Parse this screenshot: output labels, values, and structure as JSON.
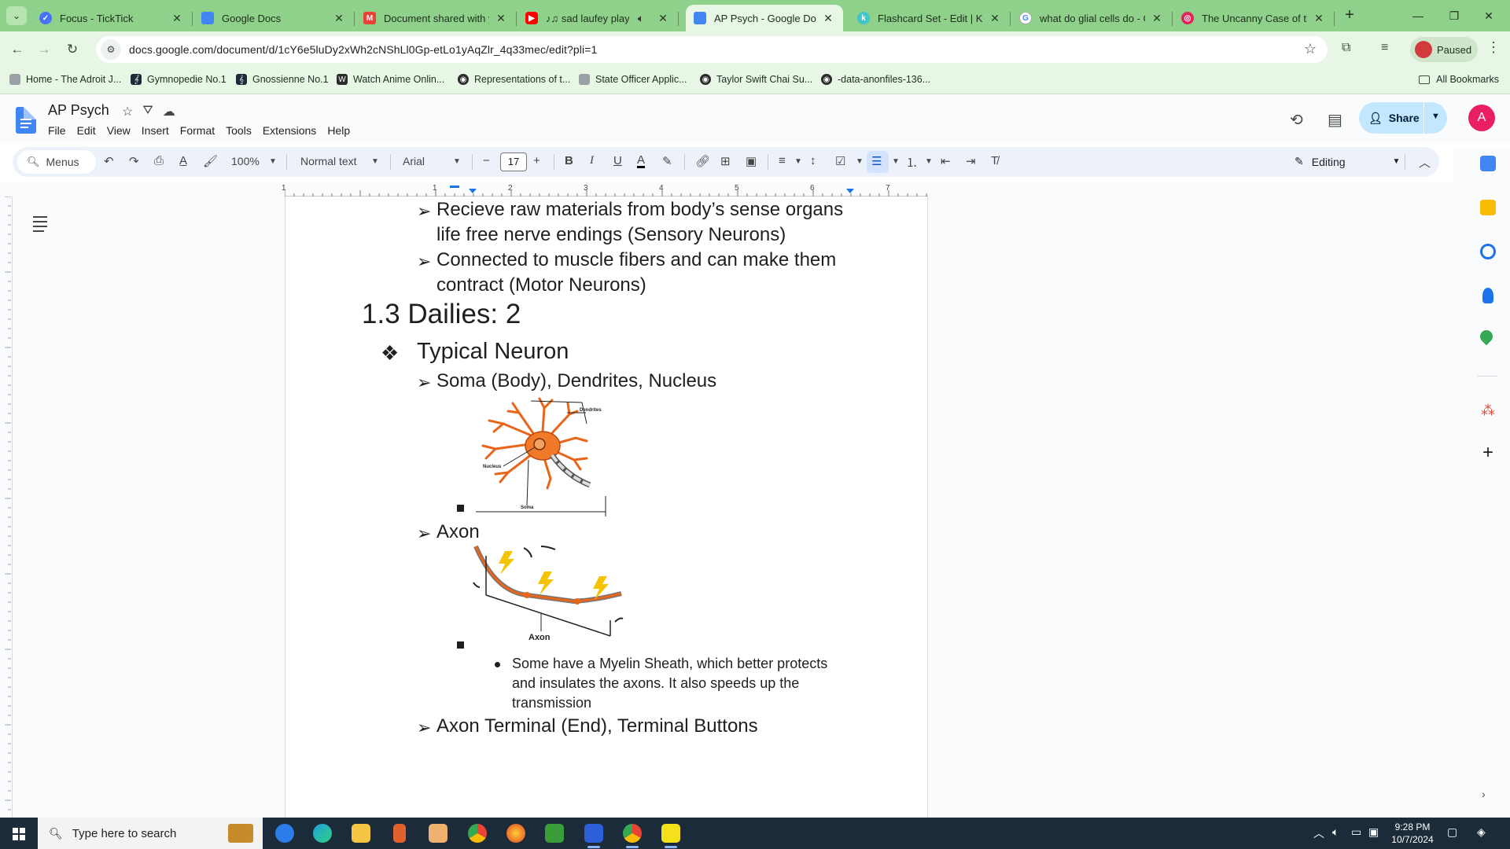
{
  "browser": {
    "tabs": [
      {
        "title": "Focus - TickTick",
        "favicon": "ticktick-icon",
        "color": "#4772fa",
        "active": false
      },
      {
        "title": "Google Docs",
        "favicon": "google-docs-icon",
        "color": "#4285f4",
        "active": false
      },
      {
        "title": "Document shared with yo",
        "favicon": "gmail-icon",
        "color": "#ea4335",
        "active": false
      },
      {
        "title": "♪♫ sad laufey playlis",
        "favicon": "youtube-icon",
        "color": "#ff0000",
        "active": false
      },
      {
        "title": "AP Psych - Google Docs",
        "favicon": "google-docs-icon",
        "color": "#4285f4",
        "active": true
      },
      {
        "title": "Flashcard Set - Edit | Kno",
        "favicon": "knowt-icon",
        "color": "#3ec6c9",
        "active": false
      },
      {
        "title": "what do glial cells do - Go",
        "favicon": "google-icon",
        "color": "#4285f4",
        "active": false
      },
      {
        "title": "The Uncanny Case of the",
        "favicon": "target-icon",
        "color": "#e0245e",
        "active": false
      }
    ],
    "url": "docs.google.com/document/d/1cY6e5luDy2xWh2cNShLl0Gp-etLo1yAqZlr_4q33mec/edit?pli=1",
    "profile_label": "Paused",
    "bookmarks": [
      {
        "label": "Home - The Adroit J...",
        "icon": "bookmark-page-icon"
      },
      {
        "label": "Gymnopedie No.1",
        "icon": "musescore-icon"
      },
      {
        "label": "Gnossienne No.1",
        "icon": "musescore-icon"
      },
      {
        "label": "Watch Anime Onlin...",
        "icon": "anime-site-icon"
      },
      {
        "label": "Representations of t...",
        "icon": "globe-icon"
      },
      {
        "label": "State Officer Applic...",
        "icon": "bookmark-page-icon"
      },
      {
        "label": "Taylor Swift Chai Su...",
        "icon": "globe-icon"
      },
      {
        "label": "-data-anonfiles-136...",
        "icon": "globe-icon"
      }
    ],
    "all_bookmarks_label": "All Bookmarks"
  },
  "docs": {
    "title": "AP Psych",
    "menus": [
      "File",
      "Edit",
      "View",
      "Insert",
      "Format",
      "Tools",
      "Extensions",
      "Help"
    ],
    "share_label": "Share",
    "account_initial": "A",
    "toolbar": {
      "menus_search": "Menus",
      "zoom": "100%",
      "style": "Normal text",
      "font": "Arial",
      "font_size": "17",
      "mode": "Editing"
    },
    "ruler_numbers": [
      "1",
      "1",
      "2",
      "3",
      "4",
      "5",
      "6",
      "7"
    ],
    "content": {
      "bullet1_line1": "Recieve raw materials from body’s sense organs",
      "bullet1_line2": "life free nerve endings (Sensory Neurons)",
      "bullet2_line1": "Connected to muscle fibers and can make them",
      "bullet2_line2": "contract (Motor Neurons)",
      "heading": "1.3 Dailies: 2",
      "topic": "Typical Neuron",
      "item_soma": "Soma (Body), Dendrites, Nucleus",
      "neuron_labels": {
        "dendrites": "Dendrites",
        "nucleus": "Nucleus",
        "soma": "Soma"
      },
      "item_axon": "Axon",
      "axon_label": "Axon",
      "myelin_line1": "Some have a Myelin Sheath, which better protects",
      "myelin_line2": "and insulates the axons. It also speeds up the",
      "myelin_line3": "transmission",
      "item_terminal": "Axon Terminal (End), Terminal Buttons"
    }
  },
  "taskbar": {
    "search_placeholder": "Type here to search",
    "time": "9:28 PM",
    "date": "10/7/2024"
  }
}
